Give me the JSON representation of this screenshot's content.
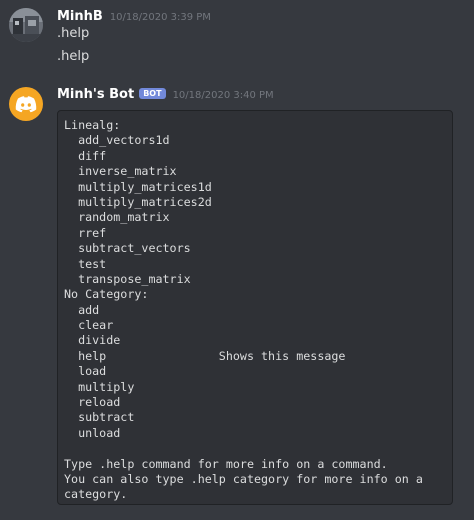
{
  "messages": [
    {
      "author": "MinhB",
      "timestamp": "10/18/2020 3:39 PM",
      "lines": [
        ".help",
        ".help"
      ]
    },
    {
      "author": "Minh's Bot",
      "bot_tag": "BOT",
      "timestamp": "10/18/2020 3:40 PM",
      "code_lines": [
        "Linealg:",
        "  add_vectors1d",
        "  diff",
        "  inverse_matrix",
        "  multiply_matrices1d",
        "  multiply_matrices2d",
        "  random_matrix",
        "  rref",
        "  subtract_vectors",
        "  test",
        "  transpose_matrix",
        "No Category:",
        "  add",
        "  clear",
        "  divide",
        "  help                Shows this message",
        "  load",
        "  multiply",
        "  reload",
        "  subtract",
        "  unload",
        "",
        "Type .help command for more info on a command.",
        "You can also type .help category for more info on a",
        "category."
      ]
    }
  ],
  "colors": {
    "background": "#36393f",
    "codeblock_bg": "#2f3136",
    "bot_tag": "#7289da",
    "bot_avatar": "#f5a623",
    "username": "#ffffff",
    "timestamp": "#72767d"
  },
  "icons": {
    "user_avatar": "user-avatar-image",
    "bot_avatar": "discord-logo-icon"
  }
}
